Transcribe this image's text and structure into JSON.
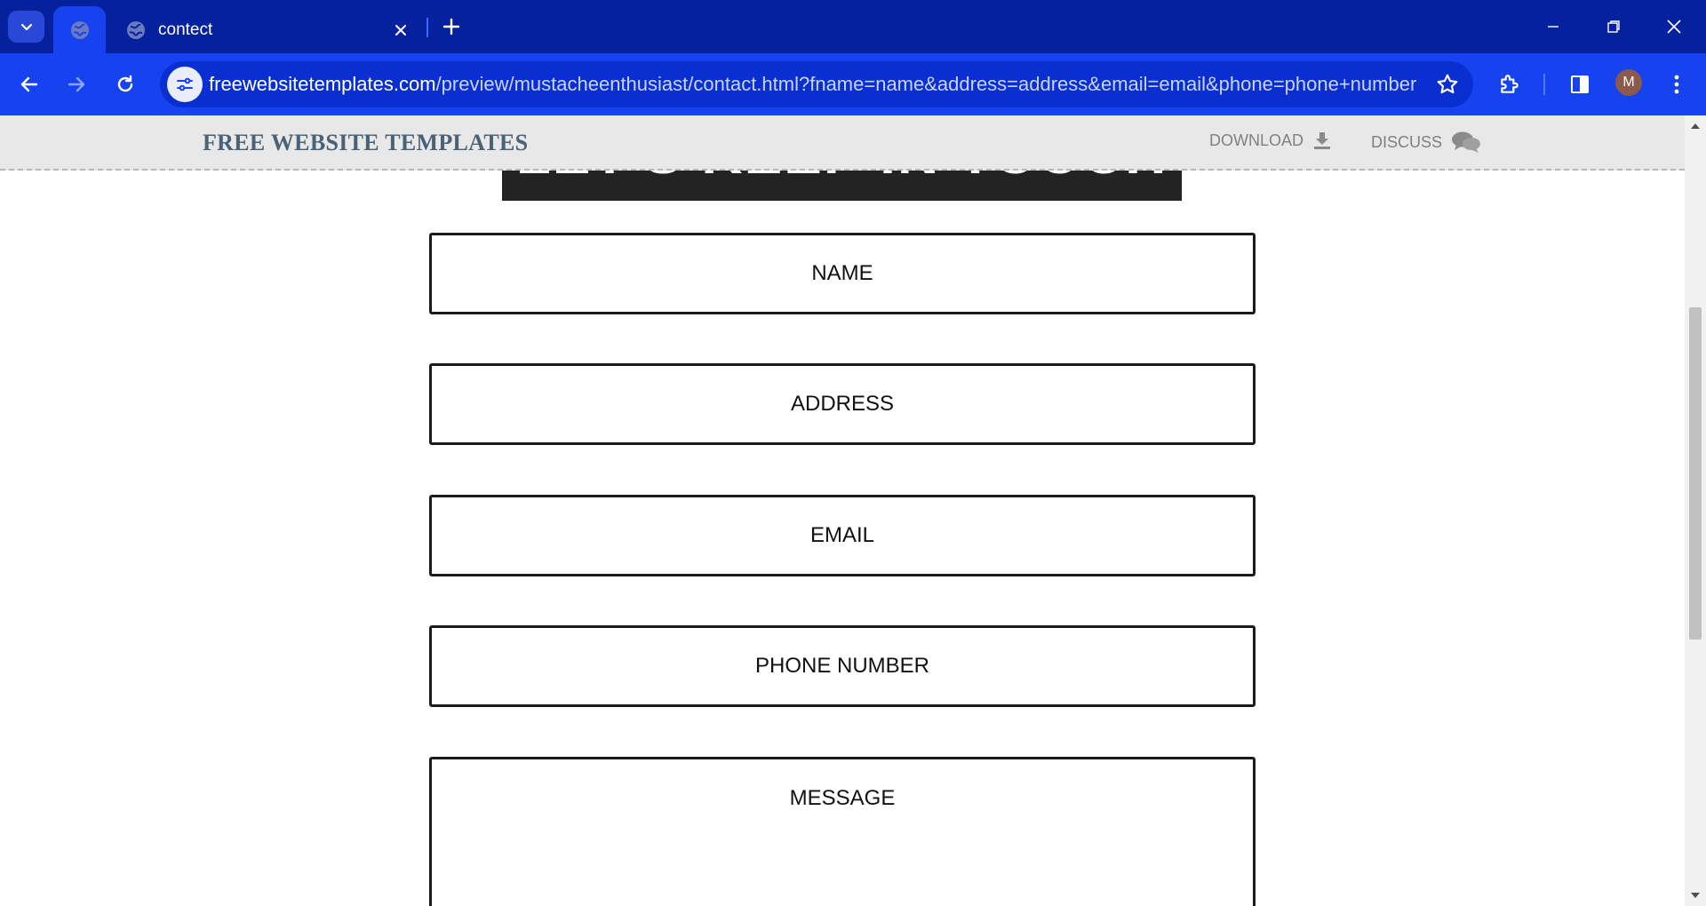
{
  "browser": {
    "tabs": [
      {
        "title": "",
        "active": true
      },
      {
        "title": "contect",
        "active": false
      }
    ],
    "url_host": "freewebsitetemplates.com",
    "url_path": "/preview/mustacheenthusiast/contact.html?fname=name&address=address&email=email&phone=phone+number&m...",
    "profile_initial": "M",
    "colors": {
      "tabbar": "#06219e",
      "toolbar": "#1642f0"
    }
  },
  "fwt_bar": {
    "logo": "FREE WEBSITE TEMPLATES",
    "download": "DOWNLOAD",
    "discuss": "DISCUSS"
  },
  "page": {
    "heading": "LET'S KEEP IN TOUCH",
    "fields": {
      "name": "NAME",
      "address": "ADDRESS",
      "email": "EMAIL",
      "phone": "PHONE NUMBER",
      "message": "MESSAGE"
    }
  }
}
